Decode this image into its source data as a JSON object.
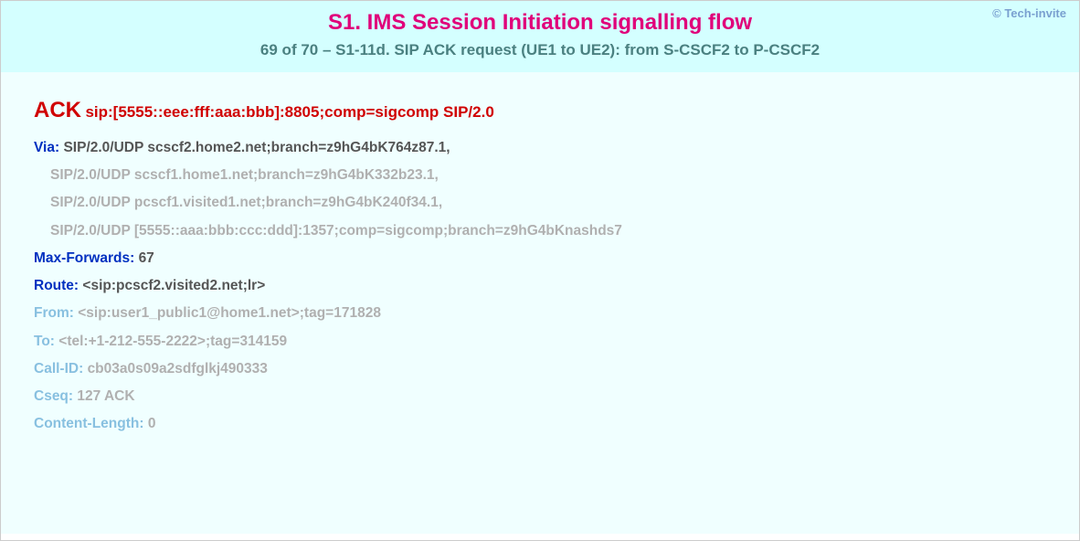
{
  "copyright": "© Tech-invite",
  "title": "S1. IMS Session Initiation signalling flow",
  "subtitle": "69 of 70 – S1-11d. SIP ACK request (UE1 to UE2): from S-CSCF2 to P-CSCF2",
  "request": {
    "method": "ACK",
    "uri": "sip:[5555::eee:fff:aaa:bbb]:8805;comp=sigcomp SIP/2.0"
  },
  "headers": {
    "via": {
      "name": "Via:",
      "first": "SIP/2.0/UDP scscf2.home2.net;branch=z9hG4bK764z87.1,",
      "cont": [
        "SIP/2.0/UDP scscf1.home1.net;branch=z9hG4bK332b23.1,",
        "SIP/2.0/UDP pcscf1.visited1.net;branch=z9hG4bK240f34.1,",
        "SIP/2.0/UDP [5555::aaa:bbb:ccc:ddd]:1357;comp=sigcomp;branch=z9hG4bKnashds7"
      ]
    },
    "maxforwards": {
      "name": "Max-Forwards:",
      "value": "67"
    },
    "route": {
      "name": "Route:",
      "value": "<sip:pcscf2.visited2.net;lr>"
    },
    "from": {
      "name": "From:",
      "value": "<sip:user1_public1@home1.net>;tag=171828"
    },
    "to": {
      "name": "To:",
      "value": "<tel:+1-212-555-2222>;tag=314159"
    },
    "callid": {
      "name": "Call-ID:",
      "value": "cb03a0s09a2sdfglkj490333"
    },
    "cseq": {
      "name": "Cseq:",
      "value": "127 ACK"
    },
    "clen": {
      "name": "Content-Length:",
      "value": "0"
    }
  }
}
